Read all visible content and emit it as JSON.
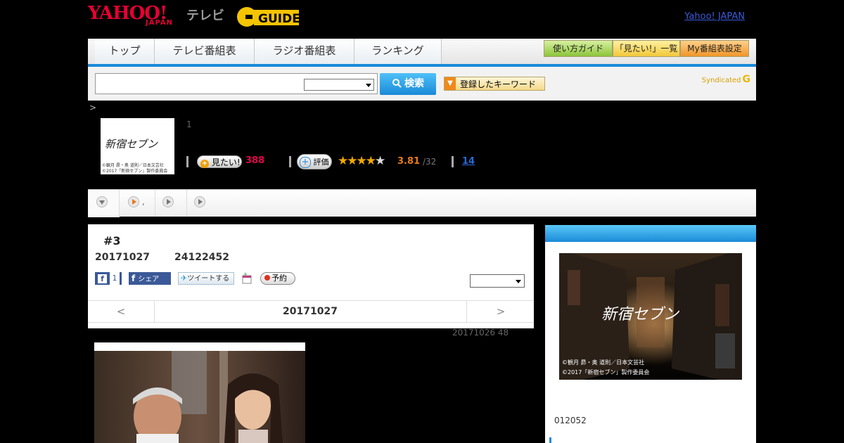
{
  "header": {
    "logo_yahoo": "YAHOO!",
    "logo_japan": "JAPAN",
    "logo_tv": "テレビ",
    "yahoo_japan_link": "Yahoo! JAPAN"
  },
  "nav": {
    "tabs": [
      "トップ",
      "テレビ番組表",
      "ラジオ番組表",
      "ランキング"
    ],
    "right_buttons": [
      "使い方ガイド",
      "「見たい!」一覧",
      "My番組表設定"
    ]
  },
  "search": {
    "button_label": "検索",
    "keyword_button": "登録したキーワード",
    "syndicated": "Syndicated"
  },
  "breadcrumb": ">",
  "program": {
    "thumb_title": "新宿セブン",
    "thumb_credit_1": "©観月 昴・奥 道則／日本文芸社",
    "thumb_credit_2": "©2017「新宿セブン」製作委員会",
    "number": "1",
    "mitai_label": "見たい!",
    "mitai_count": "388",
    "hyoka_label": "評価",
    "rating": "3.81",
    "rating_count": "/32",
    "comments": "14"
  },
  "subnav": {
    "separator": ","
  },
  "episode": {
    "title": "#3",
    "date": "20171027",
    "time": "24122452",
    "fb_like_count": "1",
    "fb_share": "シェア",
    "tweet": "ツイートする",
    "reserve": "予約",
    "nav_prev": "<",
    "nav_next": ">",
    "nav_date": "20171027"
  },
  "updated": "20171026  48",
  "sidebar": {
    "info_text": "012052",
    "image_title": "新宿セブン",
    "credit_1": "©観月 昴・奥 道則／日本文芸社",
    "credit_2": "©2017「新宿セブン」製作委員会"
  },
  "colors": {
    "accent_blue": "#1a8ad8",
    "mitai_pink": "#e8004d",
    "rating_orange": "#e87a1a",
    "yahoo_red": "#e60033"
  }
}
